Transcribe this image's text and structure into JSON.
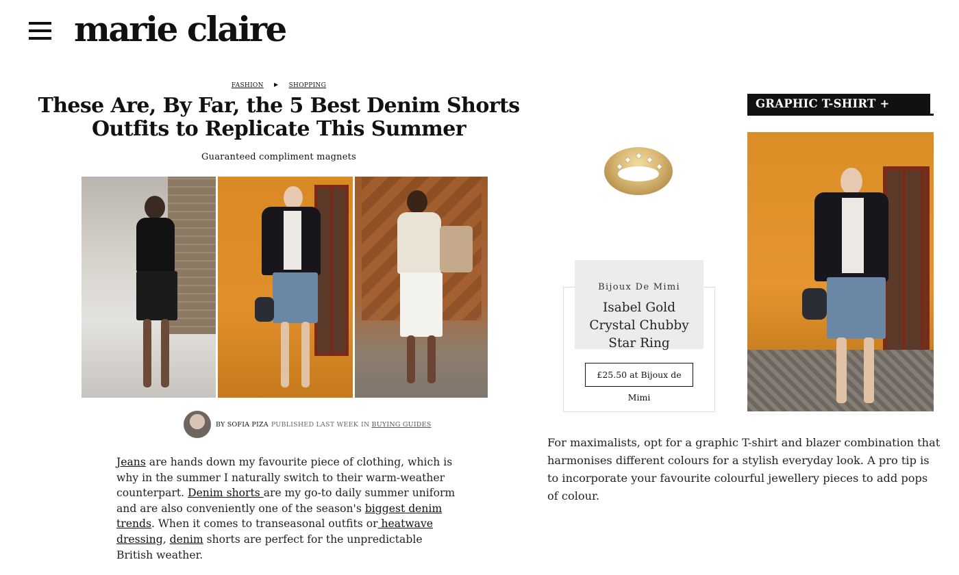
{
  "header": {
    "logo": "marie claire",
    "menu_icon": "hamburger-menu-icon"
  },
  "breadcrumb": {
    "items": [
      "FASHION",
      "SHOPPING"
    ],
    "separator_icon": "triangle-right-icon"
  },
  "article": {
    "title": "These Are, By Far, the 5 Best Denim Shorts Outfits to Replicate This Summer",
    "subtitle": "Guaranteed compliment magnets",
    "byline": {
      "by": "BY SOFIA PIZA",
      "published": "PUBLISHED LAST WEEK",
      "in": "IN",
      "category": "BUYING GUIDES"
    },
    "body": {
      "link_jeans": "Jeans",
      "t1": " are hands down my favourite piece of clothing, which is why in the summer I naturally switch to their warm-weather counterpart. ",
      "link_denim_shorts": "Denim shorts ",
      "t2": "are my go-to daily summer uniform and are also conveniently one of the season's ",
      "link_trends": "biggest denim trends",
      "t3": ". When it comes to transeasonal outfits or",
      "link_heatwave": " heatwave dressing",
      "t4": ", ",
      "link_denim": "denim",
      "t5": " shorts are perfect for the unpredictable British weather."
    }
  },
  "sidebar": {
    "section_label": "GRAPHIC T-SHIRT + BLAZER",
    "product": {
      "brand": "Bijoux De Mimi",
      "name": "Isabel Gold Crystal Chubby Star Ring",
      "button": "£25.50 at Bijoux de Mimi"
    },
    "description": "For maximalists, opt for a graphic T-shirt and blazer combination that harmonises different colours for a stylish everyday look. A pro tip is to incorporate your favourite colourful jewellery pieces to add pops of colour."
  },
  "colors": {
    "text": "#111111",
    "card_bg": "#ececec",
    "label_bg": "#111111",
    "orange_wall": "#e08f2a"
  }
}
